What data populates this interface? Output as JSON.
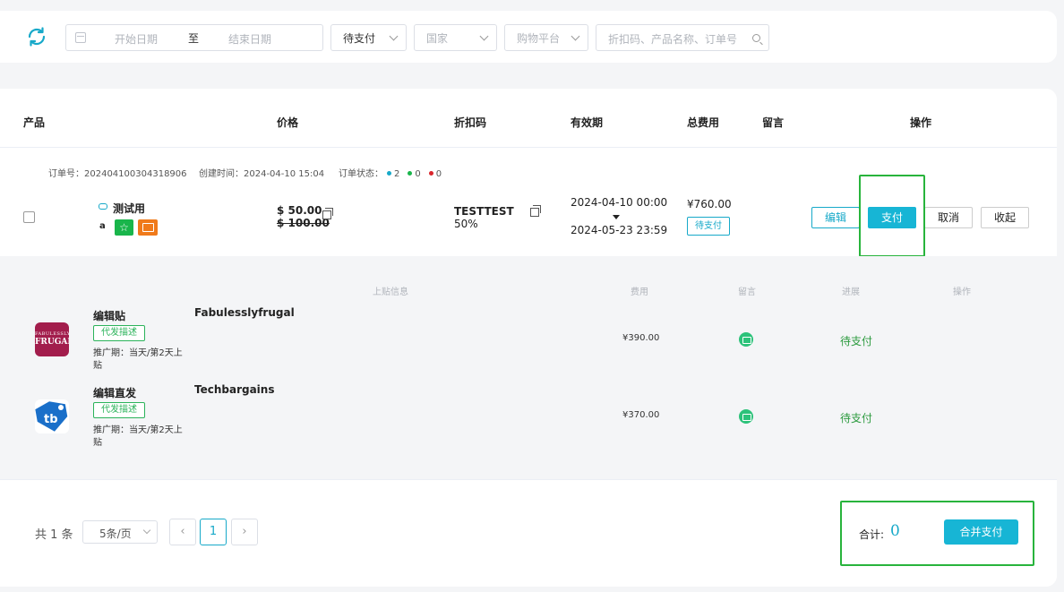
{
  "filters": {
    "start_date": "开始日期",
    "separator": "至",
    "end_date": "结束日期",
    "status": "待支付",
    "country": "国家",
    "platform": "购物平台",
    "search_placeholder": "折扣码、产品名称、订单号"
  },
  "table": {
    "headers": [
      "产品",
      "价格",
      "折扣码",
      "有效期",
      "总费用",
      "留言",
      "操作"
    ]
  },
  "order": {
    "number_label": "订单号：",
    "number": "202404100304318906",
    "created_label": "创建时间：",
    "created": "2024-04-10 15:04",
    "status_label": "订单状态：",
    "status_counts": [
      "2",
      "0",
      "0"
    ],
    "status_colors": [
      "#17a9c9",
      "#19b54b",
      "#d9252b"
    ],
    "product_name": "测试用",
    "amazon_glyph": "a",
    "price": "$ 50.00",
    "price_original": "$ 100.00",
    "code": "TESTTEST",
    "discount": "50%",
    "valid_from": "2024-04-10 00:00",
    "valid_to": "2024-05-23 23:59",
    "total": "¥760.00",
    "status_tag": "待支付",
    "actions": {
      "edit": "编辑",
      "pay": "支付",
      "cancel": "取消",
      "collapse": "收起"
    }
  },
  "sub_table": {
    "headers": [
      "上贴信息",
      "费用",
      "留言",
      "进展",
      "操作"
    ],
    "rows": [
      {
        "logo_small": "FABULESSLY",
        "logo_big": "FRUGAL",
        "name": "编辑贴",
        "tag": "代发描述",
        "period": "推广期：当天/第2天上贴",
        "site": "Fabulesslyfrugal",
        "fee": "¥390.00",
        "progress": "待支付"
      },
      {
        "logo_text": "tb",
        "name": "编辑直发",
        "tag": "代发描述",
        "period": "推广期：当天/第2天上贴",
        "site": "Techbargains",
        "fee": "¥370.00",
        "progress": "待支付"
      }
    ]
  },
  "footer": {
    "total_count": "共 1 条",
    "page_size": "5条/页",
    "current_page": "1",
    "sum_label": "合计:",
    "sum_value": "0",
    "merge_pay": "合并支付"
  },
  "colors": {
    "accent": "#17b5d5",
    "highlight": "#28b43c",
    "success": "#2b9a3e"
  }
}
